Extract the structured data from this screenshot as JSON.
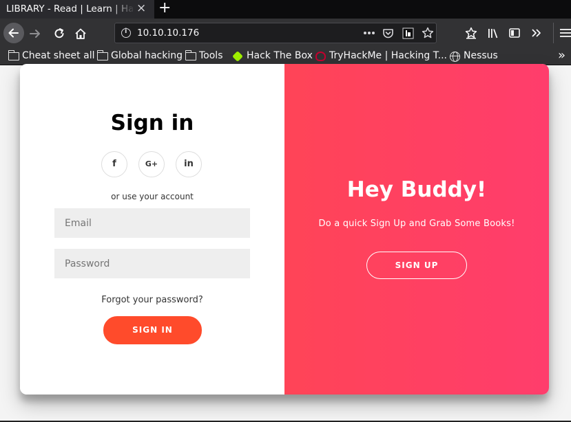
{
  "browser": {
    "tab": {
      "title": "LIBRARY - Read | Learn | Have Fun",
      "close_icon": "×"
    },
    "new_tab_icon": "+",
    "url": "10.10.10.176",
    "bookmarks": [
      {
        "label": "Cheat sheet all",
        "icon": "folder-icon"
      },
      {
        "label": "Global hacking",
        "icon": "folder-icon"
      },
      {
        "label": "Tools",
        "icon": "folder-icon"
      },
      {
        "label": "Hack The Box",
        "icon": "htb-icon"
      },
      {
        "label": "TryHackMe | Hacking T...",
        "icon": "thm-icon"
      },
      {
        "label": "Nessus",
        "icon": "globe-icon"
      }
    ],
    "overflow_icon": "»"
  },
  "signin": {
    "title": "Sign in",
    "social": {
      "facebook": "f",
      "google": "G+",
      "linkedin": "in"
    },
    "alt_text": "or use your account",
    "email_placeholder": "Email",
    "password_placeholder": "Password",
    "forgot": "Forgot your password?",
    "button": "SIGN IN"
  },
  "overlay": {
    "title": "Hey Buddy!",
    "subtitle": "Do a quick Sign Up and Grab Some Books!",
    "button": "SIGN UP"
  },
  "colors": {
    "accent": "#ff4b2b",
    "gradient_start": "#ff4457",
    "gradient_end": "#ff3d6c",
    "browser_dark": "#323234"
  }
}
